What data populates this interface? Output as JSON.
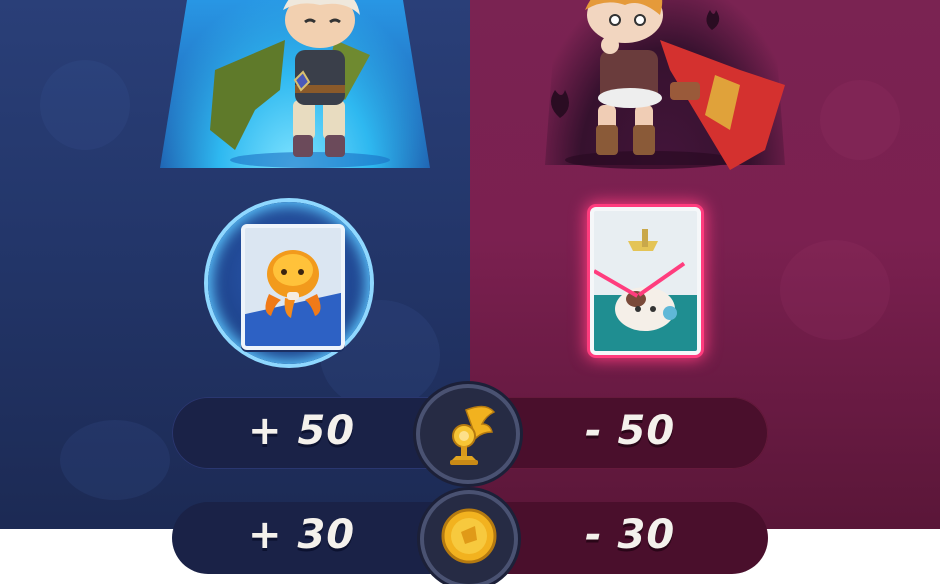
{
  "rewards": {
    "trophy": {
      "gain": "+ 50",
      "loss": "- 50",
      "icon": "winged-trophy-icon"
    },
    "coins": {
      "gain": "+ 30",
      "loss": "- 30",
      "icon": "gold-coin-icon"
    }
  },
  "colors": {
    "winner_side": "#23366a",
    "loser_side": "#7b2050",
    "winner_glow": "#2eb8f0",
    "loser_card_glow": "#ff3d7e"
  }
}
